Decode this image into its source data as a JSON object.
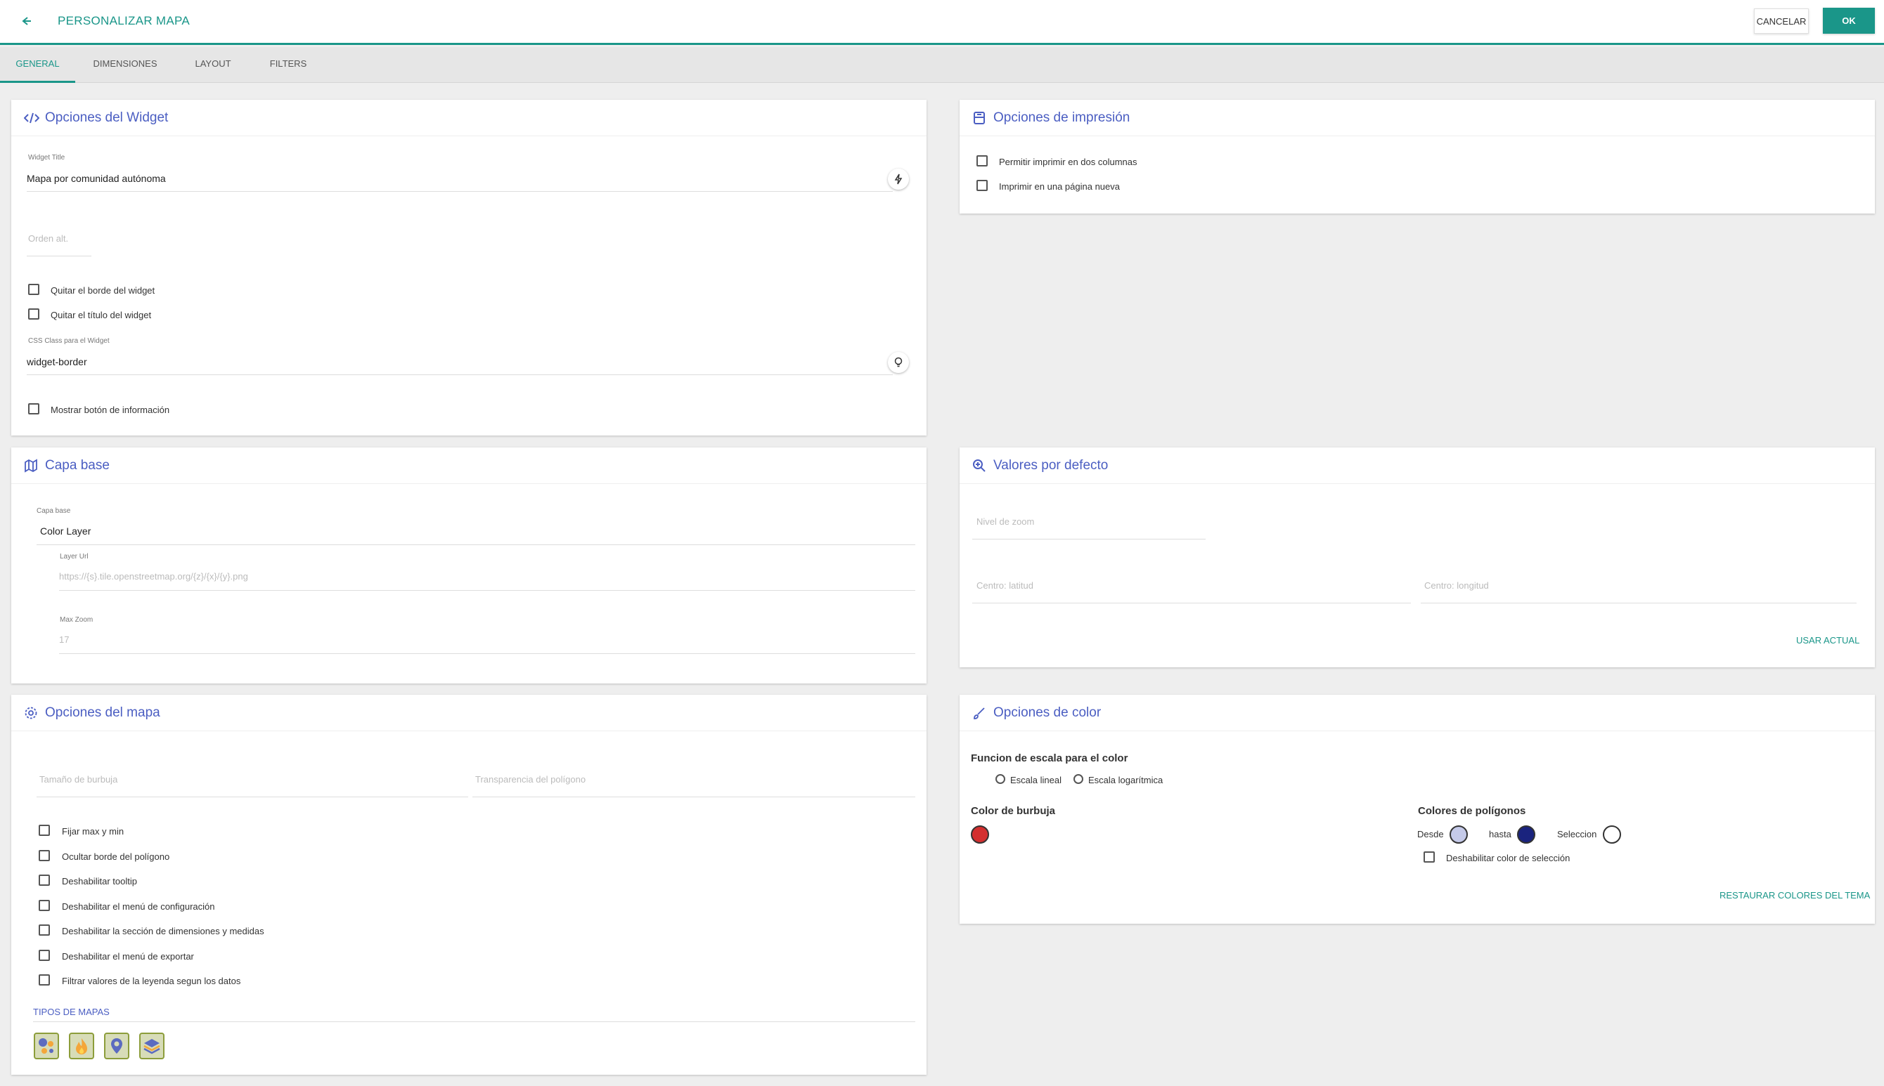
{
  "header": {
    "title": "PERSONALIZAR MAPA",
    "cancel": "CANCELAR",
    "ok": "OK"
  },
  "tabs": [
    {
      "label": "GENERAL",
      "active": true
    },
    {
      "label": "DIMENSIONES",
      "active": false
    },
    {
      "label": "LAYOUT",
      "active": false
    },
    {
      "label": "FILTERS",
      "active": false
    }
  ],
  "widget_options": {
    "title": "Opciones del Widget",
    "widget_title_label": "Widget Title",
    "widget_title_value": "Mapa por comunidad autónoma",
    "order_placeholder": "Orden alt.",
    "checks": [
      "Quitar el borde del widget",
      "Quitar el título del widget"
    ],
    "css_label": "CSS Class para el Widget",
    "css_value": "widget-border",
    "info_check": "Mostrar botón de información"
  },
  "print_options": {
    "title": "Opciones de impresión",
    "checks": [
      "Permitir imprimir en dos columnas",
      "Imprimir en una página nueva"
    ]
  },
  "base_layer": {
    "title": "Capa base",
    "layer_label": "Capa base",
    "layer_value": "Color Layer",
    "url_label": "Layer Url",
    "url_placeholder": "https://{s}.tile.openstreetmap.org/{z}/{x}/{y}.png",
    "zoom_label": "Max Zoom",
    "zoom_placeholder": "17"
  },
  "defaults": {
    "title": "Valores por defecto",
    "zoom_placeholder": "Nivel de zoom",
    "lat_placeholder": "Centro: latitud",
    "lng_placeholder": "Centro: longitud",
    "use_current": "USAR ACTUAL"
  },
  "map_options": {
    "title": "Opciones del mapa",
    "bubble_placeholder": "Tamaño de burbuja",
    "transparency_placeholder": "Transparencia del polígono",
    "checks": [
      "Fijar max y min",
      "Ocultar borde del polígono",
      "Deshabilitar tooltip",
      "Deshabilitar el menú de configuración",
      "Deshabilitar la sección de dimensiones y medidas",
      "Deshabilitar el menú de exportar",
      "Filtrar valores de la leyenda segun los datos"
    ],
    "map_types_label": "TIPOS DE MAPAS",
    "map_types": [
      "bubble-map-icon",
      "heat-map-icon",
      "marker-map-icon",
      "layers-map-icon"
    ]
  },
  "color_options": {
    "title": "Opciones de color",
    "scale_label": "Funcion de escala para el color",
    "scale_options": [
      "Escala lineal",
      "Escala logarítmica"
    ],
    "bubble_label": "Color de burbuja",
    "bubble_color": "#d32f2f",
    "polygon_label": "Colores de polígonos",
    "from_label": "Desde",
    "from_color": "#c5cae9",
    "to_label": "hasta",
    "to_color": "#1a237e",
    "selection_label": "Seleccion",
    "selection_color": "#ffffff",
    "disable_selection": "Deshabilitar color de selección",
    "restore": "RESTAURAR COLORES DEL TEMA"
  }
}
